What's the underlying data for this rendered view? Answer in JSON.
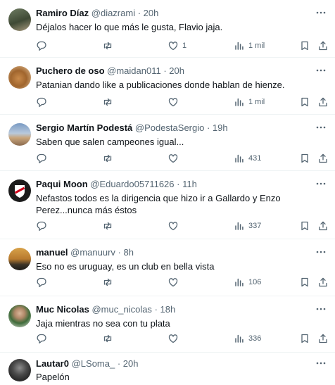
{
  "tweets": [
    {
      "name": "Ramiro Díaz",
      "handle": "@diazrami",
      "time": "· 20h",
      "text": "Déjalos hacer lo que más le gusta, Flavio jaja.",
      "likes": "1",
      "views": "1 mil"
    },
    {
      "name": "Puchero de oso",
      "handle": "@maidan011",
      "time": "· 20h",
      "text": "Patanian dando like a publicaciones donde hablan de hienze.",
      "likes": "",
      "views": "1 mil"
    },
    {
      "name": "Sergio Martín Podestá",
      "handle": "@PodestaSergio",
      "time": "· 19h",
      "text": "Saben que salen campeones igual...",
      "likes": "",
      "views": "431"
    },
    {
      "name": "Paqui Moon",
      "handle": "@Eduardo05711626",
      "time": "· 11h",
      "text": "Nefastos todos es la dirigencia que hizo ir a Gallardo y Enzo Perez...nunca más éstos",
      "likes": "",
      "views": "337"
    },
    {
      "name": "manuel",
      "handle": "@manuurv",
      "time": "· 8h",
      "text": "Eso no es uruguay, es un club en bella vista",
      "likes": "",
      "views": "106"
    },
    {
      "name": "Muc Nicolas",
      "handle": "@muc_nicolas",
      "time": "· 18h",
      "text": "Jaja mientras no sea con tu plata",
      "likes": "",
      "views": "336"
    },
    {
      "name": "Lautar0",
      "handle": "@LSoma_",
      "time": "· 20h",
      "text": "Papelón",
      "likes": "",
      "views": ""
    }
  ],
  "icons": {
    "reply": "reply-icon",
    "retweet": "retweet-icon",
    "like": "like-icon",
    "views": "views-icon",
    "bookmark": "bookmark-icon",
    "share": "share-icon",
    "more": "more-icon"
  },
  "colors": {
    "text": "#0f1419",
    "secondary": "#536471",
    "divider": "#eff3f4"
  }
}
